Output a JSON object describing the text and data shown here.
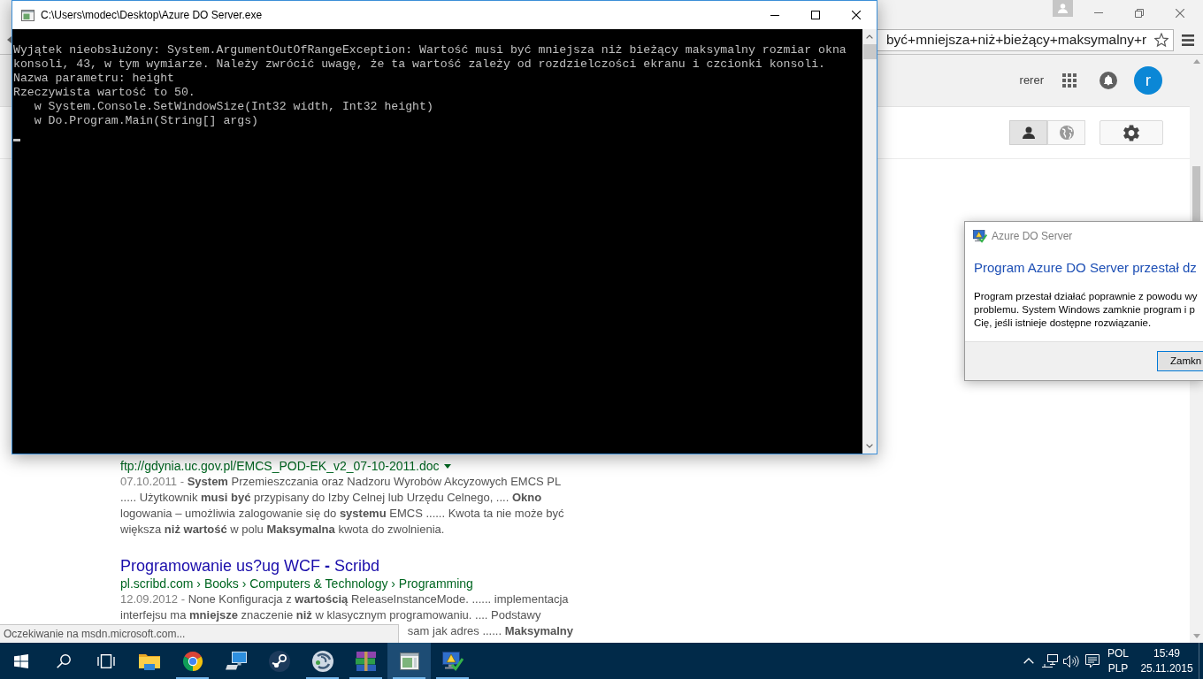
{
  "browser": {
    "address_bar": {
      "value": "być+mniejsza+niż+bieżący+maksymalny+r"
    },
    "account": {
      "name": "rerer",
      "avatar_letter": "r"
    },
    "view_toggle": [
      {
        "selected": true
      },
      {
        "selected": false
      }
    ],
    "results": [
      {
        "url": "ftp://gdynia.uc.gov.pl/EMCS_POD-EK_v2_07-10-2011.doc",
        "menu_caret": true,
        "date": "07.10.2011 -",
        "snippet": "**System** Przemieszczania oraz Nadzoru Wyrobów Akcyzowych EMCS PL ..... Użytkownik **musi być** przypisany do Izby Celnej lub Urzędu Celnego, .... **Okno** logowania – umożliwia zalogowanie się do **systemu** EMCS ...... Kwota ta nie może być większa **niż wartość** w polu **Maksymalna** kwota do zwolnienia."
      },
      {
        "title": "Programowanie us?ug WCF **-** Scribd",
        "url": "pl.scribd.com › Books › Computers & Technology › Programming",
        "menu_caret": false,
        "date": "12.09.2012 -",
        "snippet": "None Konfiguracja z **wartością** ReleaseInstanceMode. ...... implementacja interfejsu ma **mniejsze** znaczenie **niż** w klasycznym programowaniu. .... Podstawy",
        "snippet_tail": "sam jak adres ...... **Maksymalny**"
      }
    ],
    "status_bar": {
      "text": "Oczekiwanie na msdn.microsoft.com..."
    }
  },
  "console": {
    "title": "C:\\Users\\modec\\Desktop\\Azure DO Server.exe",
    "lines": [
      "Wyjątek nieobsłużony: System.ArgumentOutOfRangeException: Wartość musi być mniejsza niż bieżący maksymalny rozmiar okna",
      "konsoli, 43, w tym wymiarze. Należy zwrócić uwagę, że ta wartość zależy od rozdzielczości ekranu i czcionki konsoli.",
      "Nazwa parametru: height",
      "Rzeczywista wartość to 50.",
      "   w System.Console.SetWindowSize(Int32 width, Int32 height)",
      "   w Do.Program.Main(String[] args)"
    ]
  },
  "dialog": {
    "title": "Azure DO Server",
    "heading": "Program Azure DO Server przestał dz",
    "message_lines": [
      "Program przestał działać poprawnie z powodu wy",
      "problemu. System Windows zamknie program i p",
      "Cię, jeśli istnieje dostępne rozwiązanie."
    ],
    "buttons": [
      "Zamkn"
    ]
  },
  "taskbar": {
    "apps": [
      {
        "running": false,
        "active": false
      },
      {
        "running": true,
        "active": false
      },
      {
        "running": false,
        "active": false
      },
      {
        "running": false,
        "active": false
      },
      {
        "running": true,
        "active": false
      },
      {
        "running": true,
        "active": false
      },
      {
        "running": true,
        "active": true
      },
      {
        "running": true,
        "active": false
      }
    ],
    "tray": {
      "language": "POL",
      "keyboard": "PLP",
      "time": "15:49",
      "date": "25.11.2015"
    }
  }
}
